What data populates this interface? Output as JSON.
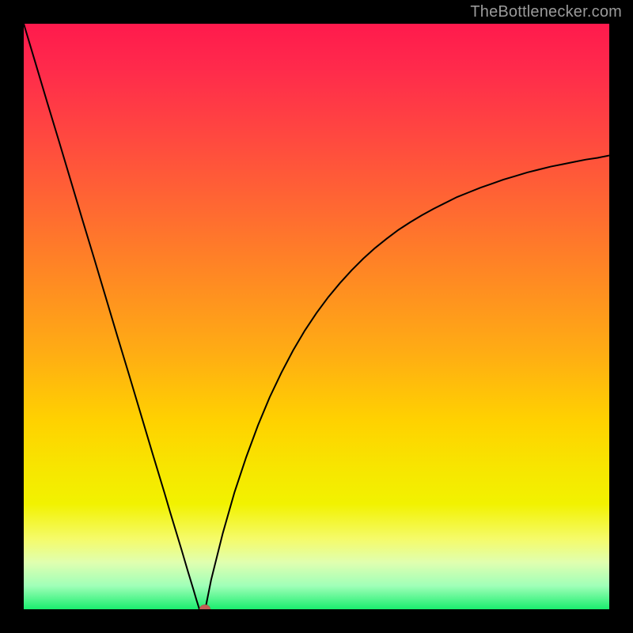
{
  "watermark": {
    "text": "TheBottlenecker.com"
  },
  "chart_data": {
    "type": "line",
    "title": "",
    "xlabel": "",
    "ylabel": "",
    "xlim": [
      0,
      100
    ],
    "ylim": [
      0,
      100
    ],
    "x": [
      0,
      2,
      4,
      6,
      8,
      10,
      12,
      14,
      16,
      18,
      20,
      22,
      24,
      25,
      26,
      27,
      28,
      29,
      29.5,
      30,
      31,
      32,
      34,
      36,
      38,
      40,
      42,
      44,
      46,
      48,
      50,
      52,
      54,
      56,
      58,
      60,
      62,
      64,
      66,
      68,
      70,
      72,
      74,
      76,
      78,
      80,
      82,
      84,
      86,
      88,
      90,
      92,
      94,
      96,
      98,
      100
    ],
    "y": [
      100,
      93.3,
      86.6,
      80.0,
      73.3,
      66.6,
      60.0,
      53.3,
      46.6,
      40.0,
      33.3,
      26.6,
      20.0,
      16.6,
      13.3,
      10.0,
      6.6,
      3.3,
      1.6,
      0.0,
      0.0,
      5.0,
      13.0,
      20.0,
      26.0,
      31.4,
      36.2,
      40.4,
      44.2,
      47.6,
      50.6,
      53.3,
      55.7,
      57.9,
      59.9,
      61.7,
      63.3,
      64.8,
      66.1,
      67.3,
      68.4,
      69.4,
      70.4,
      71.2,
      72.0,
      72.7,
      73.4,
      74.0,
      74.6,
      75.1,
      75.6,
      76.0,
      76.4,
      76.8,
      77.1,
      77.5
    ],
    "min_marker": {
      "x": 31,
      "y": 0
    }
  },
  "colors": {
    "curve": "#000000",
    "marker": "#c56055",
    "frame": "#000000"
  }
}
